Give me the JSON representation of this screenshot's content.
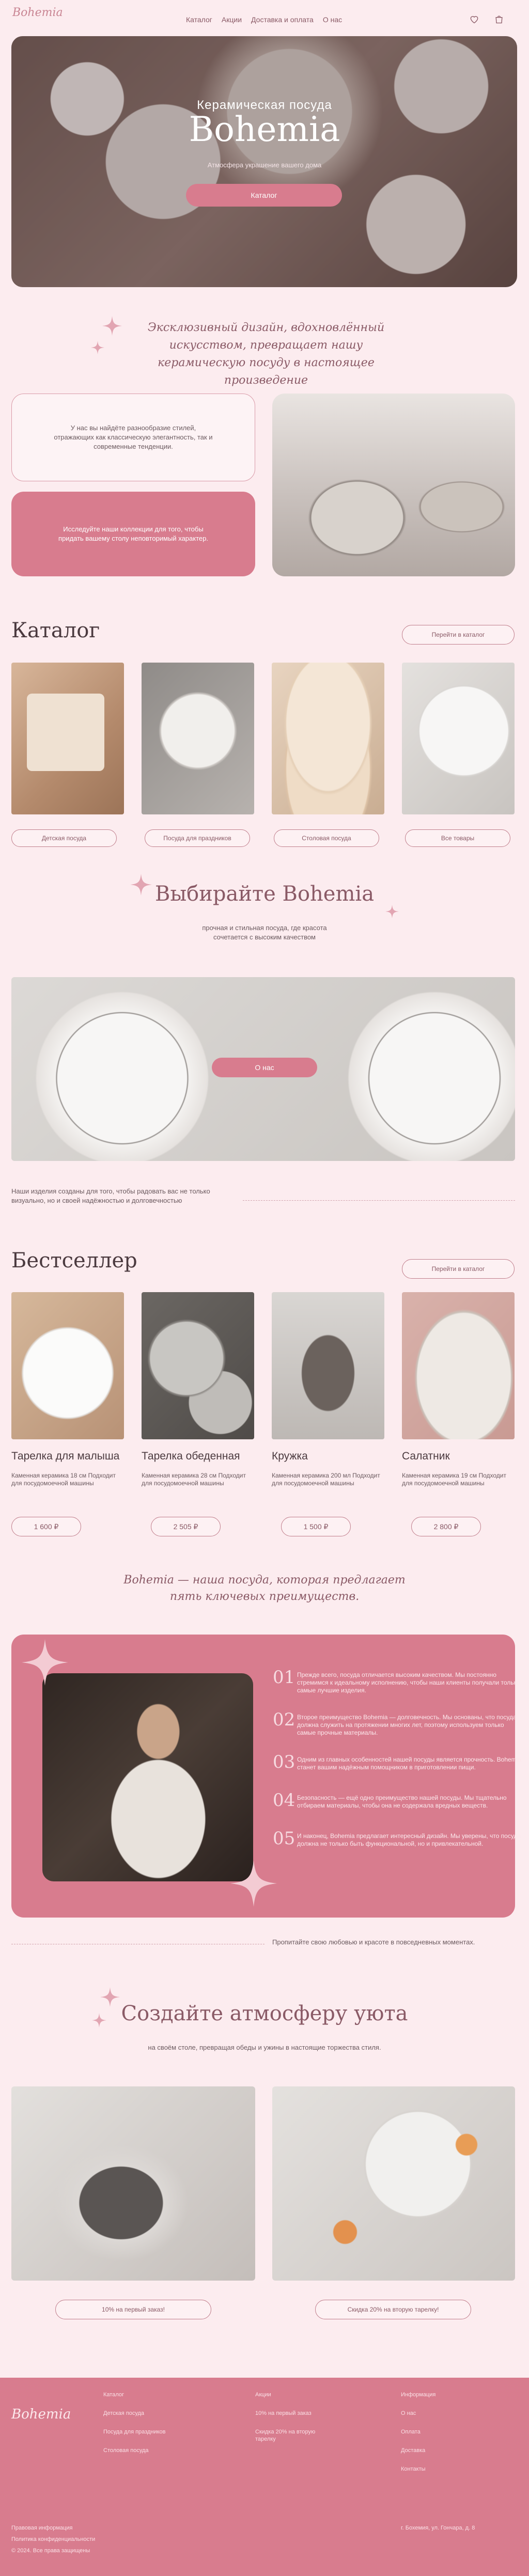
{
  "header": {
    "logo": "Bohemia",
    "nav": [
      "Каталог",
      "Акции",
      "Доставка и оплата",
      "О нас"
    ],
    "icons": [
      "heart-icon",
      "bag-icon"
    ]
  },
  "hero": {
    "subtitle": "Керамическая посуда",
    "title": "Bohemia",
    "tagline": "Атмосфера украшение вашего дома",
    "button": "Каталог"
  },
  "intro": {
    "text": "Эксклюзивный дизайн, вдохновлённый искусством, превращает нашу керамическую посуду в настоящее произведение"
  },
  "about_cards": {
    "card1": "У нас вы найдёте разнообразие стилей, отражающих как классическую элегантность, так и современные тенденции.",
    "card2": "Исследуйте наши коллекции для того, чтобы придать вашему столу неповторимый характер."
  },
  "catalog": {
    "title": "Каталог",
    "button": "Перейти в каталог",
    "items": [
      "Детская посуда",
      "Посуда для праздников",
      "Столовая посуда",
      "Все товары"
    ]
  },
  "choose": {
    "title": "Выбирайте Bohemia",
    "subtitle": "прочная и стильная посуда, где красота сочетается с высоким качеством",
    "button": "О нас",
    "note": "Наши изделия созданы для того, чтобы радовать вас не только визуально, но и своей надёжностью и долговечностью"
  },
  "bestseller": {
    "title": "Бестселлер",
    "button": "Перейти в каталог",
    "products": [
      {
        "name": "Тарелка для малыша",
        "desc": "Каменная керамика 18 см Подходит для посудомоечной машины",
        "price": "1 600 ₽"
      },
      {
        "name": "Тарелка обеденная",
        "desc": "Каменная керамика 28 см Подходит для посудомоечной машины",
        "price": "2 505 ₽"
      },
      {
        "name": "Кружка",
        "desc": "Каменная керамика 200 мл Подходит для посудомоечной машины",
        "price": "1 500 ₽"
      },
      {
        "name": "Салатник",
        "desc": "Каменная керамика 19 см Подходит для посудомоечной машины",
        "price": "2 800 ₽"
      }
    ]
  },
  "advantages": {
    "title": "Bohemia — наша посуда, которая предлагает пять ключевых преимуществ.",
    "items": [
      {
        "num": "01",
        "text": "Прежде всего, посуда отличается высоким качеством. Мы постоянно стремимся к идеальному исполнению, чтобы наши клиенты получали только самые лучшие изделия."
      },
      {
        "num": "02",
        "text": "Второе преимущество Bohemia — долговечность. Мы основаны, что посуда должна служить на протяжении многих лет, поэтому используем только самые прочные материалы."
      },
      {
        "num": "03",
        "text": "Одним из главных особенностей нашей посуды является прочность. Bohemia станет вашим надёжным помощником в приготовлении пищи."
      },
      {
        "num": "04",
        "text": "Безопасность — ещё одно преимущество нашей посуды. Мы тщательно отбираем материалы, чтобы она не содержала вредных веществ."
      },
      {
        "num": "05",
        "text": "И наконец, Bohemia предлагает интересный дизайн. Мы уверены, что посуда должна не только быть функциональной, но и привлекательной."
      }
    ],
    "note": "Пропитайте свою любовью и красоте в повседневных моментах."
  },
  "cozy": {
    "title": "Создайте атмосферу уюта",
    "subtitle": "на своём столе, превращая обеды и ужины в настоящие торжества стиля.",
    "promo1": "10% на первый заказ!",
    "promo2": "Скидка 20% на вторую тарелку!"
  },
  "footer": {
    "logo": "Bohemia",
    "col1": [
      "Каталог",
      "Детская посуда",
      "Посуда для праздников",
      "Столовая посуда"
    ],
    "col2": [
      "Акции",
      "10% на первый заказ",
      "Скидка 20% на вторую тарелку"
    ],
    "col3": [
      "Информация",
      "О нас",
      "Оплата",
      "Доставка",
      "Контакты"
    ],
    "legal": [
      "Правовая информация",
      "Политика конфиденциальности"
    ],
    "copy": "© 2024. Все права защищены",
    "address": "г. Бохемия, ул. Гончара, д. 8"
  }
}
